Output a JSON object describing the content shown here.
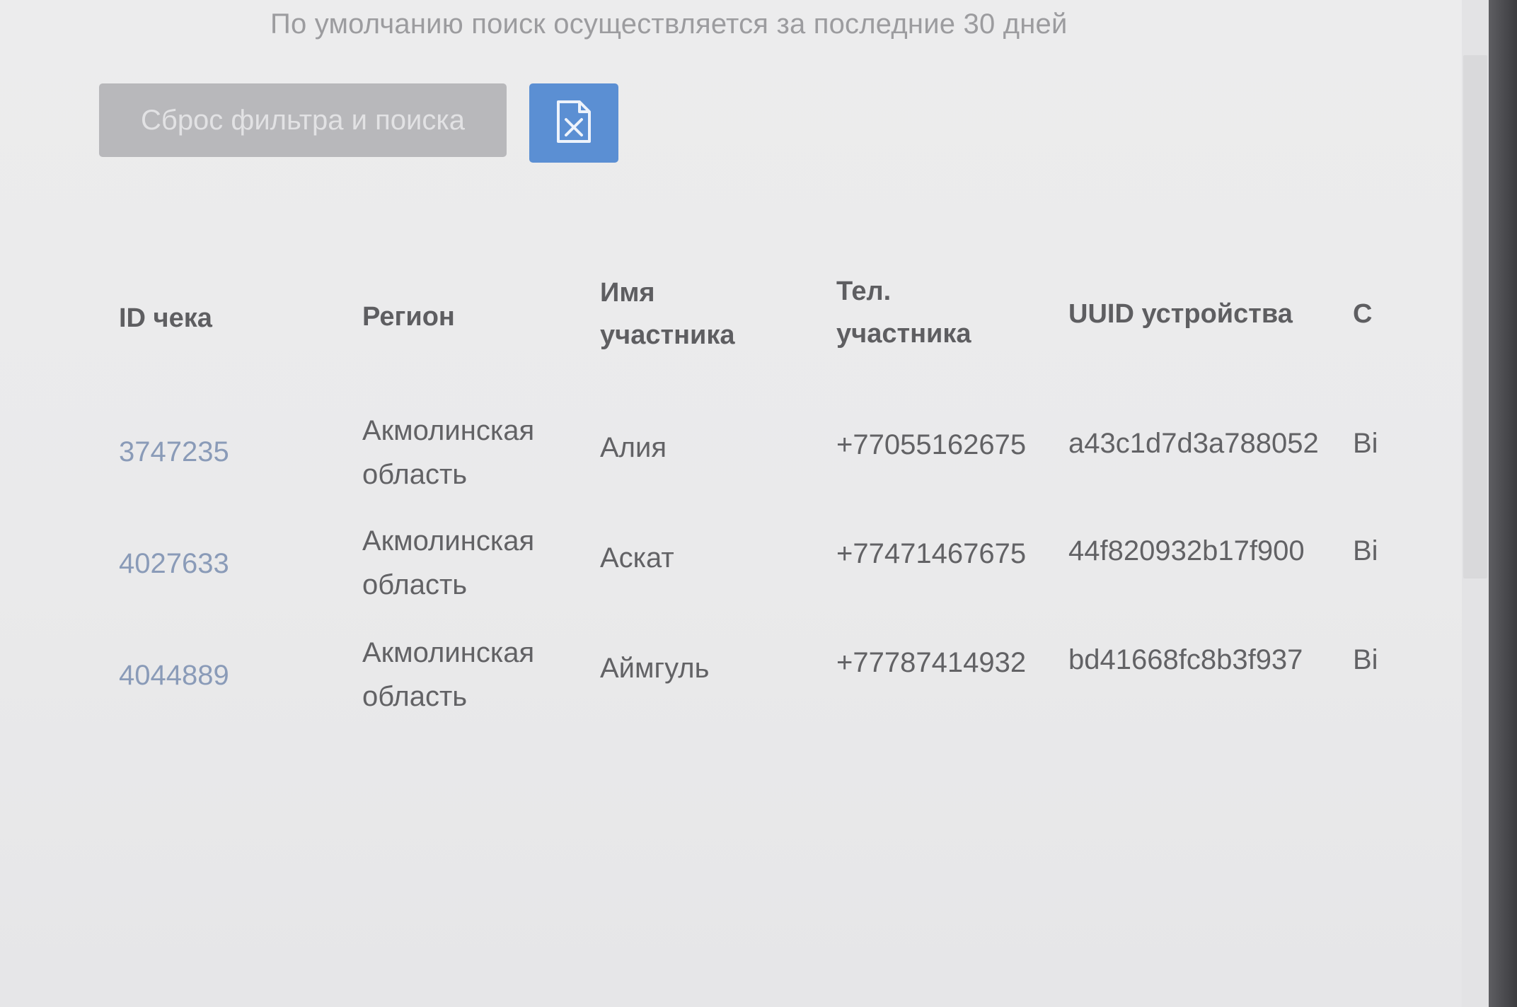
{
  "filter": {
    "hint": "По умолчанию поиск осуществляется за последние 30 дней",
    "reset_label": "Сброс фильтра и поиска"
  },
  "table": {
    "headers": {
      "id": "ID чека",
      "region": "Регион",
      "name_line1": "Имя",
      "name_line2": "участника",
      "phone_line1": "Тел.",
      "phone_line2": "участника",
      "uuid": "UUID устройства",
      "next": "С"
    },
    "rows": [
      {
        "id": "3747235",
        "region_line1": "Акмолинская",
        "region_line2": "область",
        "name": "Алия",
        "phone": "+77055162675",
        "uuid": "a43c1d7d3a788052",
        "next": "Ві"
      },
      {
        "id": "4027633",
        "region_line1": "Акмолинская",
        "region_line2": "область",
        "name": "Аскат",
        "phone": "+77471467675",
        "uuid": "44f820932b17f900",
        "next": "Ві"
      },
      {
        "id": "4044889",
        "region_line1": "Акмолинская",
        "region_line2": "область",
        "name": "Аймгуль",
        "phone": "+77787414932",
        "uuid": "bd41668fc8b3f937",
        "next": "Ві"
      }
    ]
  },
  "icons": {
    "excel": "excel-file-icon"
  },
  "colors": {
    "excel_button": "#5b8fd3",
    "reset_button": "#b8b8bb",
    "link": "#8a9bb8"
  }
}
